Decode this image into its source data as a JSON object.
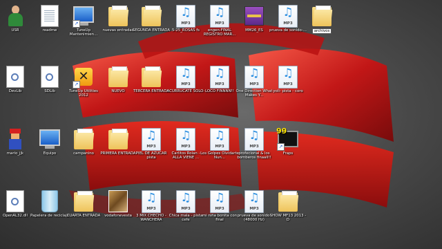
{
  "desktop": {
    "icons": [
      {
        "label": "USR",
        "type": "person"
      },
      {
        "label": "readme",
        "type": "doc"
      },
      {
        "label": "TuneUp Mantenimien...",
        "type": "monitor",
        "shortcut": true
      },
      {
        "label": "nuevas entradas",
        "type": "folder"
      },
      {
        "label": "SEGUNDA ENTRADA",
        "type": "folder"
      },
      {
        "label": "5-25_ROSAS fs",
        "type": "mp3"
      },
      {
        "label": "engen-FINAL REGISTRO MAR...",
        "type": "mp3"
      },
      {
        "label": "MM26_ES",
        "type": "rar"
      },
      {
        "label": "prueva de sonido-...",
        "type": "mp3"
      },
      {
        "label": "archivos",
        "type": "folder",
        "boxed": true
      },
      {
        "label": "DevLib",
        "type": "docgear"
      },
      {
        "label": "SDLib",
        "type": "docgear"
      },
      {
        "label": "TuneUp Utilities 2012",
        "type": "tuneup",
        "shortcut": true
      },
      {
        "label": "NUEVO",
        "type": "folder"
      },
      {
        "label": "TERCERA ENTRADA",
        "type": "folder"
      },
      {
        "label": "ACURRUCATE SOLO-",
        "type": "mp3"
      },
      {
        "label": "LOCO FINNNN!!",
        "type": "mp3"
      },
      {
        "label": "One Direction What Makes Y...",
        "type": "mp3"
      },
      {
        "label": "yoli- pista - coro",
        "type": "mp3"
      },
      {
        "label": "mario_jjk",
        "type": "mario"
      },
      {
        "label": "Equipo",
        "type": "monitor"
      },
      {
        "label": "campanino",
        "type": "folder"
      },
      {
        "label": "PRIMERA ENTRADA",
        "type": "folder"
      },
      {
        "label": "PIEL DE AZUCAR pista",
        "type": "mp3"
      },
      {
        "label": "Carlitos Rolan - ALLA VIENE ...",
        "type": "mp3"
      },
      {
        "label": "Los Golpes Olvidarte Nun...",
        "type": "mp3"
      },
      {
        "label": "profecional & los bomberos finaall!!",
        "type": "mp3"
      },
      {
        "label": "Fraps",
        "type": "fraps",
        "shortcut": true
      },
      {
        "label": "OpenAL32.dll",
        "type": "docgear"
      },
      {
        "label": "Papelera de reciclaje",
        "type": "bin"
      },
      {
        "label": "CUARTA ENTRADA",
        "type": "folder"
      },
      {
        "label": "vodafonevesta",
        "type": "pic"
      },
      {
        "label": "3 MIX CHECHO - WANCHERA",
        "type": "mp3"
      },
      {
        "label": "Chica mala - pista cefe",
        "type": "mp3"
      },
      {
        "label": "mi niña bonita con final",
        "type": "mp3"
      },
      {
        "label": "prueva de sonido-(48000 Hz)",
        "type": "mp3"
      },
      {
        "label": "SHOW MF13 2013 - D",
        "type": "folder"
      }
    ],
    "mp3_tag": "MP3",
    "fraps_badge": "99",
    "colors": {
      "accent": "#c81414",
      "highlight": "#ff3a2a"
    }
  }
}
